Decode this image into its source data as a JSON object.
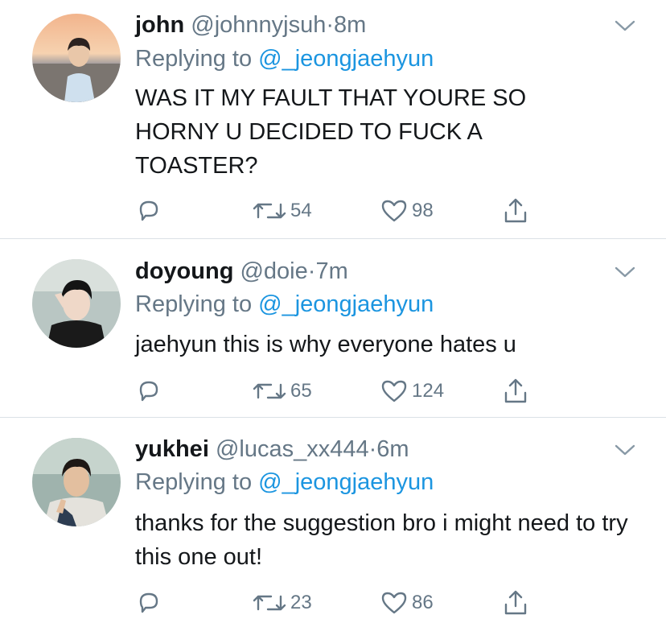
{
  "tweets": [
    {
      "name": "john",
      "handle": "@johnnyjsuh",
      "separator": "·",
      "time": "8m",
      "replying_prefix": "Replying to",
      "replying_to": "@_jeongjaehyun",
      "text": "WAS IT MY FAULT THAT YOURE SO HORNY U DECIDED TO FUCK A TOASTER?",
      "retweets": "54",
      "likes": "98"
    },
    {
      "name": "doyoung",
      "handle": "@doie",
      "separator": "·",
      "time": "7m",
      "replying_prefix": "Replying to",
      "replying_to": "@_jeongjaehyun",
      "text": "jaehyun this is why everyone hates u",
      "retweets": "65",
      "likes": "124"
    },
    {
      "name": "yukhei",
      "handle": "@lucas_xx444",
      "separator": "·",
      "time": "6m",
      "replying_prefix": "Replying to",
      "replying_to": "@_jeongjaehyun",
      "text": "thanks for the suggestion bro i might need to try this one out!",
      "retweets": "23",
      "likes": "86"
    }
  ],
  "icons": {
    "reply": "reply-icon",
    "retweet": "retweet-icon",
    "like": "heart-icon",
    "share": "share-icon",
    "caret": "chevron-down-icon"
  },
  "colors": {
    "text": "#14171a",
    "muted": "#657786",
    "link": "#1b95e0",
    "divider": "#dbe1e6"
  }
}
